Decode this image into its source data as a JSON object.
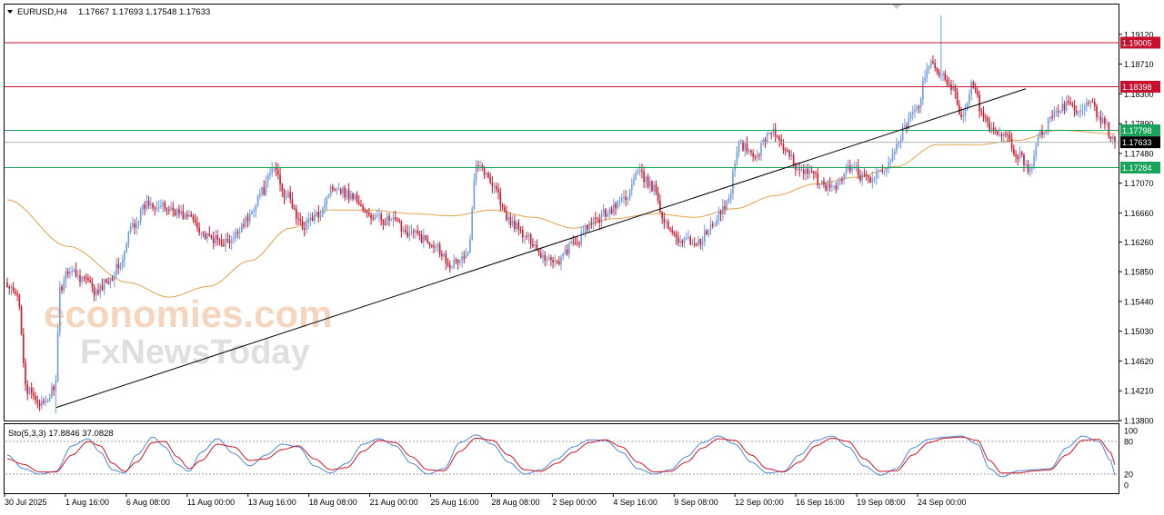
{
  "header": {
    "symbol_label": "EURUSD,H4",
    "ohlc": "1.17667 1.17693 1.17548 1.17633"
  },
  "indicator": {
    "label": "Sto(5,3,3) 17.8846 37.0828",
    "levels": [
      "100",
      "80",
      "20",
      "0"
    ]
  },
  "watermark": {
    "line1": "economies.com",
    "line2": "FxNewsToday"
  },
  "colors": {
    "bull": "#6f9be0",
    "bear": "#d01628",
    "ma": "#e0a24a",
    "resistance": "#c8102e",
    "support": "#1aa35a",
    "trendline": "#000000",
    "stoch_main": "#4a8ad6",
    "stoch_signal": "#d01628"
  },
  "chart_data": [
    {
      "type": "candlestick",
      "symbol": "EURUSD",
      "timeframe": "H4",
      "ylim": [
        1.138,
        1.1953
      ],
      "y_ticks": [
        "1.19120",
        "1.18710",
        "1.18300",
        "1.17890",
        "1.17480",
        "1.17070",
        "1.16660",
        "1.16260",
        "1.15850",
        "1.15440",
        "1.15030",
        "1.14620",
        "1.14210",
        "1.13800"
      ],
      "x_ticks": [
        "30 Jul 2025",
        "1 Aug 16:00",
        "6 Aug 08:00",
        "11 Aug 00:00",
        "13 Aug 16:00",
        "18 Aug 08:00",
        "21 Aug 00:00",
        "25 Aug 16:00",
        "28 Aug 08:00",
        "2 Sep 00:00",
        "4 Sep 16:00",
        "9 Sep 08:00",
        "12 Sep 00:00",
        "16 Sep 16:00",
        "19 Sep 08:00",
        "24 Sep 00:00"
      ],
      "price_anchors": [
        [
          0,
          1.1563
        ],
        [
          5,
          1.155
        ],
        [
          10,
          1.142
        ],
        [
          14,
          1.141
        ],
        [
          18,
          1.14
        ],
        [
          24,
          1.143
        ],
        [
          26,
          1.156
        ],
        [
          30,
          1.1588
        ],
        [
          38,
          1.1576
        ],
        [
          44,
          1.1555
        ],
        [
          50,
          1.1575
        ],
        [
          56,
          1.1595
        ],
        [
          62,
          1.165
        ],
        [
          70,
          1.168
        ],
        [
          80,
          1.1672
        ],
        [
          90,
          1.166
        ],
        [
          100,
          1.163
        ],
        [
          110,
          1.1625
        ],
        [
          118,
          1.1655
        ],
        [
          126,
          1.1695
        ],
        [
          132,
          1.1728
        ],
        [
          138,
          1.169
        ],
        [
          146,
          1.1648
        ],
        [
          152,
          1.166
        ],
        [
          162,
          1.1703
        ],
        [
          170,
          1.169
        ],
        [
          180,
          1.166
        ],
        [
          190,
          1.1655
        ],
        [
          200,
          1.1638
        ],
        [
          210,
          1.1626
        ],
        [
          220,
          1.1596
        ],
        [
          228,
          1.1607
        ],
        [
          232,
          1.1738
        ],
        [
          240,
          1.1708
        ],
        [
          248,
          1.1655
        ],
        [
          258,
          1.163
        ],
        [
          266,
          1.1605
        ],
        [
          272,
          1.16
        ],
        [
          280,
          1.1622
        ],
        [
          290,
          1.1653
        ],
        [
          298,
          1.167
        ],
        [
          306,
          1.1688
        ],
        [
          312,
          1.172
        ],
        [
          320,
          1.17
        ],
        [
          326,
          1.1648
        ],
        [
          334,
          1.1628
        ],
        [
          342,
          1.1625
        ],
        [
          348,
          1.1645
        ],
        [
          356,
          1.1678
        ],
        [
          362,
          1.176
        ],
        [
          370,
          1.1745
        ],
        [
          378,
          1.178
        ],
        [
          386,
          1.1745
        ],
        [
          392,
          1.1728
        ],
        [
          398,
          1.1718
        ],
        [
          405,
          1.17
        ],
        [
          410,
          1.1705
        ],
        [
          418,
          1.173
        ],
        [
          424,
          1.1712
        ],
        [
          432,
          1.1718
        ],
        [
          438,
          1.1745
        ],
        [
          444,
          1.1782
        ],
        [
          450,
          1.1812
        ],
        [
          456,
          1.187
        ],
        [
          462,
          1.1855
        ],
        [
          468,
          1.184
        ],
        [
          472,
          1.18
        ],
        [
          478,
          1.1845
        ],
        [
          482,
          1.18
        ],
        [
          488,
          1.1775
        ],
        [
          494,
          1.177
        ],
        [
          500,
          1.1745
        ],
        [
          506,
          1.1728
        ],
        [
          512,
          1.178
        ],
        [
          518,
          1.18
        ],
        [
          524,
          1.1815
        ],
        [
          530,
          1.1803
        ],
        [
          536,
          1.1815
        ],
        [
          542,
          1.179
        ],
        [
          548,
          1.1763
        ]
      ],
      "moving_average_anchors": [
        [
          0,
          1.1684
        ],
        [
          30,
          1.162
        ],
        [
          60,
          1.157
        ],
        [
          80,
          1.155
        ],
        [
          100,
          1.1565
        ],
        [
          120,
          1.16
        ],
        [
          140,
          1.1645
        ],
        [
          160,
          1.167
        ],
        [
          180,
          1.167
        ],
        [
          200,
          1.1665
        ],
        [
          220,
          1.1662
        ],
        [
          240,
          1.167
        ],
        [
          260,
          1.166
        ],
        [
          280,
          1.1645
        ],
        [
          300,
          1.1658
        ],
        [
          320,
          1.1665
        ],
        [
          340,
          1.166
        ],
        [
          360,
          1.1672
        ],
        [
          380,
          1.169
        ],
        [
          400,
          1.1706
        ],
        [
          420,
          1.1715
        ],
        [
          440,
          1.173
        ],
        [
          460,
          1.176
        ],
        [
          480,
          1.176
        ],
        [
          500,
          1.1766
        ],
        [
          520,
          1.178
        ],
        [
          548,
          1.1775
        ]
      ],
      "horizontal_levels": [
        {
          "label": "1.19005",
          "value": 1.19005,
          "kind": "resistance"
        },
        {
          "label": "1.18398",
          "value": 1.18398,
          "kind": "resistance"
        },
        {
          "label": "1.17798",
          "value": 1.17798,
          "kind": "support"
        },
        {
          "label": "1.17284",
          "value": 1.17284,
          "kind": "support"
        }
      ],
      "current_price": {
        "label": "1.17633",
        "value": 1.17633
      },
      "trendline": {
        "points": [
          [
            1.0,
            1.1398
          ],
          [
            1.13,
            1.1837
          ]
        ]
      }
    },
    {
      "type": "line",
      "name": "Stochastic Oscillator",
      "ylim": [
        0,
        100
      ],
      "levels": [
        20,
        80
      ],
      "main_anchors": [
        [
          0,
          55
        ],
        [
          8,
          30
        ],
        [
          16,
          20
        ],
        [
          24,
          25
        ],
        [
          32,
          72
        ],
        [
          40,
          85
        ],
        [
          46,
          60
        ],
        [
          52,
          28
        ],
        [
          58,
          22
        ],
        [
          64,
          55
        ],
        [
          72,
          88
        ],
        [
          78,
          70
        ],
        [
          84,
          38
        ],
        [
          90,
          25
        ],
        [
          96,
          60
        ],
        [
          104,
          85
        ],
        [
          112,
          58
        ],
        [
          120,
          35
        ],
        [
          128,
          55
        ],
        [
          136,
          75
        ],
        [
          144,
          70
        ],
        [
          152,
          35
        ],
        [
          160,
          22
        ],
        [
          168,
          40
        ],
        [
          176,
          75
        ],
        [
          184,
          85
        ],
        [
          192,
          72
        ],
        [
          200,
          40
        ],
        [
          208,
          20
        ],
        [
          216,
          30
        ],
        [
          224,
          78
        ],
        [
          232,
          92
        ],
        [
          240,
          75
        ],
        [
          248,
          42
        ],
        [
          256,
          20
        ],
        [
          264,
          28
        ],
        [
          272,
          48
        ],
        [
          280,
          70
        ],
        [
          288,
          83
        ],
        [
          296,
          82
        ],
        [
          304,
          60
        ],
        [
          312,
          30
        ],
        [
          320,
          20
        ],
        [
          328,
          28
        ],
        [
          336,
          52
        ],
        [
          344,
          78
        ],
        [
          352,
          90
        ],
        [
          360,
          75
        ],
        [
          368,
          42
        ],
        [
          376,
          22
        ],
        [
          384,
          25
        ],
        [
          392,
          55
        ],
        [
          400,
          82
        ],
        [
          408,
          90
        ],
        [
          416,
          70
        ],
        [
          424,
          35
        ],
        [
          432,
          18
        ],
        [
          440,
          30
        ],
        [
          448,
          68
        ],
        [
          456,
          84
        ],
        [
          464,
          88
        ],
        [
          472,
          90
        ],
        [
          480,
          75
        ],
        [
          486,
          30
        ],
        [
          492,
          15
        ],
        [
          500,
          26
        ],
        [
          508,
          28
        ],
        [
          516,
          30
        ],
        [
          524,
          68
        ],
        [
          532,
          90
        ],
        [
          540,
          80
        ],
        [
          546,
          45
        ],
        [
          548,
          17.9
        ]
      ],
      "signal_anchors": [
        [
          0,
          48
        ],
        [
          8,
          38
        ],
        [
          16,
          24
        ],
        [
          24,
          24
        ],
        [
          32,
          55
        ],
        [
          40,
          80
        ],
        [
          46,
          72
        ],
        [
          52,
          40
        ],
        [
          58,
          25
        ],
        [
          64,
          42
        ],
        [
          72,
          78
        ],
        [
          78,
          80
        ],
        [
          84,
          52
        ],
        [
          90,
          30
        ],
        [
          96,
          45
        ],
        [
          104,
          75
        ],
        [
          112,
          70
        ],
        [
          120,
          45
        ],
        [
          128,
          48
        ],
        [
          136,
          65
        ],
        [
          144,
          72
        ],
        [
          152,
          48
        ],
        [
          160,
          28
        ],
        [
          168,
          32
        ],
        [
          176,
          62
        ],
        [
          184,
          82
        ],
        [
          192,
          78
        ],
        [
          200,
          52
        ],
        [
          208,
          28
        ],
        [
          216,
          26
        ],
        [
          224,
          62
        ],
        [
          232,
          86
        ],
        [
          240,
          82
        ],
        [
          248,
          55
        ],
        [
          256,
          28
        ],
        [
          264,
          25
        ],
        [
          272,
          40
        ],
        [
          280,
          60
        ],
        [
          288,
          78
        ],
        [
          296,
          83
        ],
        [
          304,
          70
        ],
        [
          312,
          42
        ],
        [
          320,
          24
        ],
        [
          328,
          25
        ],
        [
          336,
          42
        ],
        [
          344,
          68
        ],
        [
          352,
          85
        ],
        [
          360,
          82
        ],
        [
          368,
          55
        ],
        [
          376,
          30
        ],
        [
          384,
          24
        ],
        [
          392,
          42
        ],
        [
          400,
          72
        ],
        [
          408,
          86
        ],
        [
          416,
          80
        ],
        [
          424,
          48
        ],
        [
          432,
          25
        ],
        [
          440,
          26
        ],
        [
          448,
          55
        ],
        [
          456,
          78
        ],
        [
          464,
          86
        ],
        [
          472,
          88
        ],
        [
          480,
          82
        ],
        [
          486,
          45
        ],
        [
          492,
          22
        ],
        [
          500,
          22
        ],
        [
          508,
          26
        ],
        [
          516,
          28
        ],
        [
          524,
          55
        ],
        [
          532,
          82
        ],
        [
          540,
          84
        ],
        [
          546,
          60
        ],
        [
          548,
          37.1
        ]
      ]
    }
  ]
}
